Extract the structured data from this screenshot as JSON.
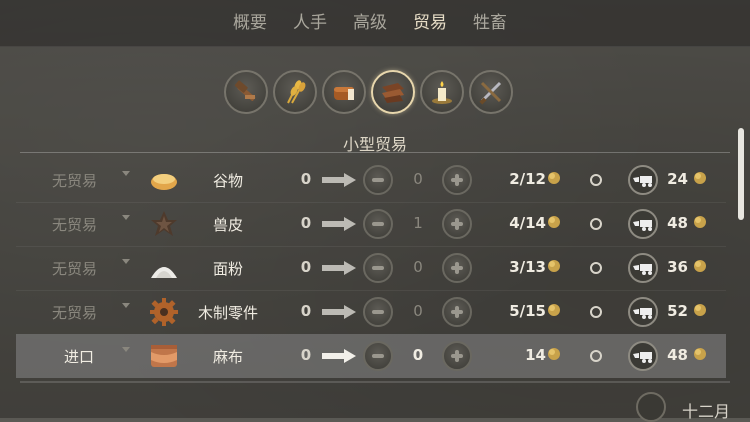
{
  "tabs": [
    {
      "label": "概要",
      "active": false
    },
    {
      "label": "人手",
      "active": false
    },
    {
      "label": "高级",
      "active": false
    },
    {
      "label": "贸易",
      "active": true
    },
    {
      "label": "牲畜",
      "active": false
    }
  ],
  "categories": [
    {
      "icon": "hammer-tools-icon",
      "active": false
    },
    {
      "icon": "wheat-icon",
      "active": false
    },
    {
      "icon": "bread-icon",
      "active": false
    },
    {
      "icon": "leather-cloth-icon",
      "active": true
    },
    {
      "icon": "candle-icon",
      "active": false
    },
    {
      "icon": "crossed-weapons-icon",
      "active": false
    }
  ],
  "section_title": "小型贸易",
  "rows": [
    {
      "status": "无贸易",
      "icon": "grain-bowl-icon",
      "name": "谷物",
      "current": "0",
      "qty": "0",
      "available": "2/12",
      "price": "24",
      "selected": false
    },
    {
      "status": "无贸易",
      "icon": "hide-icon",
      "name": "兽皮",
      "current": "0",
      "qty": "1",
      "available": "4/14",
      "price": "48",
      "selected": false
    },
    {
      "status": "无贸易",
      "icon": "flour-icon",
      "name": "面粉",
      "current": "0",
      "qty": "0",
      "available": "3/13",
      "price": "36",
      "selected": false
    },
    {
      "status": "无贸易",
      "icon": "gear-icon",
      "name": "木制零件",
      "current": "0",
      "qty": "0",
      "available": "5/15",
      "price": "52",
      "selected": false
    },
    {
      "status": "进口",
      "icon": "linen-icon",
      "name": "麻布",
      "current": "0",
      "qty": "0",
      "available": "14",
      "price": "48",
      "selected": true
    }
  ],
  "footer_text": "十二月",
  "colors": {
    "active_tab": "#e6dcc6",
    "inactive_tab": "#a9a69c",
    "selected_row": "#96969a",
    "coin": "#c8a24a"
  }
}
